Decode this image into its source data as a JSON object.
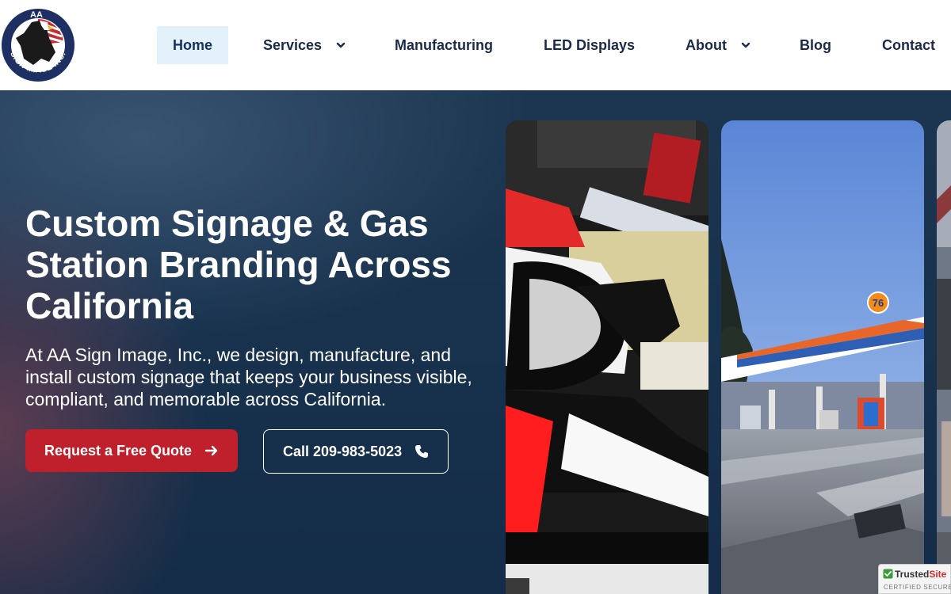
{
  "header": {
    "logo": {
      "top_text": "AA",
      "bottom_text": "SIGN IMAGE INC.",
      "icon": "eagle-flag-logo"
    },
    "nav": [
      {
        "label": "Home",
        "active": true
      },
      {
        "label": "Services",
        "dropdown": true
      },
      {
        "label": "Manufacturing"
      },
      {
        "label": "LED Displays"
      },
      {
        "label": "About",
        "dropdown": true
      },
      {
        "label": "Blog"
      },
      {
        "label": "Contact"
      }
    ]
  },
  "hero": {
    "title": "Custom Signage & Gas Station Branding Across California",
    "subtitle": "At AA Sign Image, Inc., we design, manufacture, and install custom signage that keeps your business visible, compliant, and memorable across California.",
    "quote_button": {
      "label": "Request a Free Quote",
      "icon": "arrow-right-icon"
    },
    "call_button": {
      "label": "Call 209-983-5023",
      "icon": "phone-icon"
    },
    "gallery": {
      "gas_station_sign_text": "76"
    }
  },
  "badge": {
    "title_part1": "Trusted",
    "title_part2": "Site",
    "subtitle": "CERTIFIED SECURE"
  },
  "colors": {
    "nav_text": "#1b2a48",
    "active_bg": "#e3f1fb",
    "hero_bg": "#18324e",
    "cta_red": "#c0202b"
  }
}
